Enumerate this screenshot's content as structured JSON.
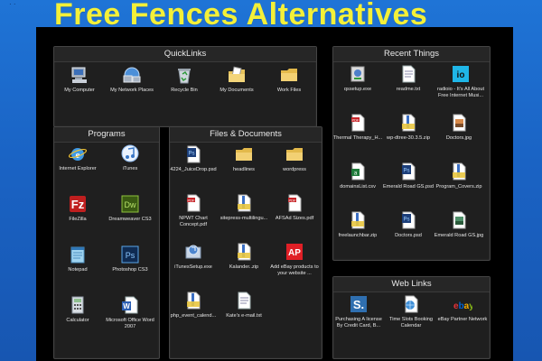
{
  "title": "Free Fences Alternatives",
  "fences": {
    "quicklinks": {
      "title": "QuickLinks",
      "items": [
        {
          "label": "My Computer",
          "icon": "computer-icon"
        },
        {
          "label": "My Network Places",
          "icon": "network-icon"
        },
        {
          "label": "Recycle Bin",
          "icon": "recycle-bin-icon"
        },
        {
          "label": "My Documents",
          "icon": "documents-folder-icon"
        },
        {
          "label": "Work Files",
          "icon": "folder-icon"
        }
      ]
    },
    "programs": {
      "title": "Programs",
      "items": [
        {
          "label": "Internet Explorer",
          "icon": "internet-explorer-icon"
        },
        {
          "label": "iTunes",
          "icon": "itunes-icon"
        },
        {
          "label": "FileZilla",
          "icon": "filezilla-icon"
        },
        {
          "label": "Dreamweaver CS3",
          "icon": "dreamweaver-icon"
        },
        {
          "label": "Notepad",
          "icon": "notepad-icon"
        },
        {
          "label": "Photoshop CS3",
          "icon": "photoshop-icon"
        },
        {
          "label": "Calculator",
          "icon": "calculator-icon"
        },
        {
          "label": "Microsoft Office Word 2007",
          "icon": "word-icon"
        }
      ]
    },
    "files": {
      "title": "Files & Documents",
      "items": [
        {
          "label": "4224_JuiceDrop.psd",
          "icon": "psd-file-icon"
        },
        {
          "label": "headlines",
          "icon": "folder-icon"
        },
        {
          "label": "wordpress",
          "icon": "folder-icon"
        },
        {
          "label": "NPWT Chart Concept.pdf",
          "icon": "pdf-file-icon"
        },
        {
          "label": "sitepress-multilingu...",
          "icon": "zip-file-icon"
        },
        {
          "label": "AFSAd Sizes.pdf",
          "icon": "pdf-file-icon"
        },
        {
          "label": "iTunesSetup.exe",
          "icon": "exe-file-icon"
        },
        {
          "label": "Kalander..zip",
          "icon": "zip-file-icon"
        },
        {
          "label": "Add eBay products to your website ...",
          "icon": "ap-app-icon"
        },
        {
          "label": "php_event_calend...",
          "icon": "zip-file-icon"
        },
        {
          "label": "Kate's e-mail.txt",
          "icon": "txt-file-icon"
        }
      ]
    },
    "recent": {
      "title": "Recent Things",
      "items": [
        {
          "label": "qssetup.exe",
          "icon": "setup-exe-icon"
        },
        {
          "label": "readme.txt",
          "icon": "txt-file-icon"
        },
        {
          "label": "radioio - It's All About Free Internet Musi...",
          "icon": "radioio-icon"
        },
        {
          "label": "Thermal Therapy_H...",
          "icon": "pdf-file-icon"
        },
        {
          "label": "wp-dtree-30.3.5.zip",
          "icon": "zip-file-icon"
        },
        {
          "label": "Doctors.jpg",
          "icon": "jpg-file-icon"
        },
        {
          "label": "domainsList.csv",
          "icon": "csv-file-icon"
        },
        {
          "label": "Emerald Road GS.psd",
          "icon": "psd-file-icon"
        },
        {
          "label": "Program_Covers.zip",
          "icon": "zip-file-icon"
        },
        {
          "label": "freelaunchbar.zip",
          "icon": "zip-file-icon"
        },
        {
          "label": "Doctors.psd",
          "icon": "psd-file-icon"
        },
        {
          "label": "Emerald Road GS.jpg",
          "icon": "jpg-file-icon"
        }
      ]
    },
    "weblinks": {
      "title": "Web Links",
      "items": [
        {
          "label": "Purchasing A license By Credit Card, B...",
          "icon": "s-link-icon"
        },
        {
          "label": "Time Slots Booking Calendar",
          "icon": "globe-link-icon"
        },
        {
          "label": "eBay Partner Network",
          "icon": "ebay-icon"
        }
      ]
    }
  }
}
